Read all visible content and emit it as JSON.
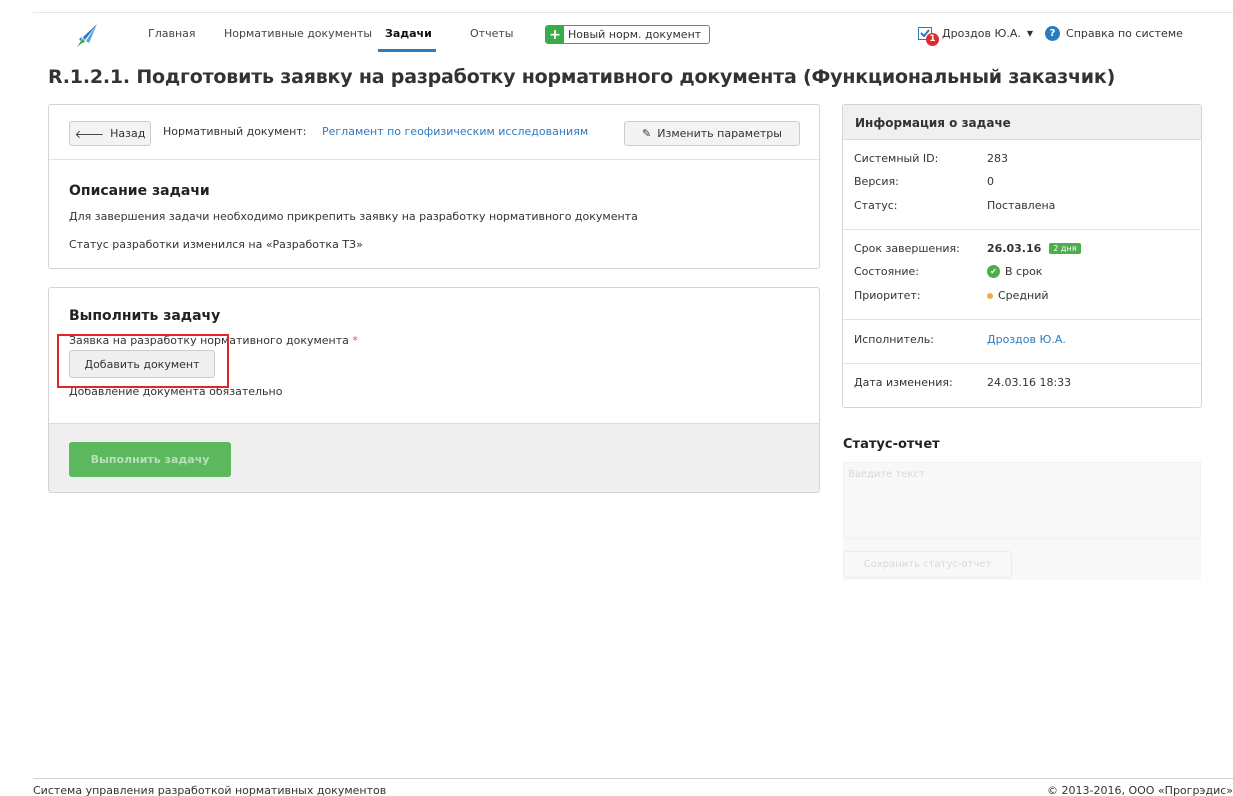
{
  "nav": {
    "items": [
      "Главная",
      "Нормативные документы",
      "Задачи",
      "Отчеты"
    ],
    "active": "Задачи",
    "new_doc": "Новый норм. документ",
    "user": "Дроздов Ю.А.",
    "notifications": "1",
    "help": "Справка по системе"
  },
  "page_title": "R.1.2.1. Подготовить заявку на разработку нормативного документа (Функциональный заказчик)",
  "task": {
    "back": "Назад",
    "doc_label": "Нормативный документ:",
    "doc_link": "Регламент по геофизическим исследованиям",
    "edit_params": "Изменить параметры",
    "desc_title": "Описание задачи",
    "desc_text": "Для завершения задачи необходимо прикрепить заявку на разработку нормативного документа",
    "status_text": "Статус разработки изменился на «Разработка ТЗ»"
  },
  "execute": {
    "title": "Выполнить задачу",
    "field_label": "Заявка на разработку нормативного документа",
    "required_mark": "*",
    "add_doc": "Добавить документ",
    "hint": "Добавление документа обязательно",
    "exec_btn": "Выполнить задачу"
  },
  "info": {
    "title": "Информация о задаче",
    "system_id_label": "Системный ID:",
    "system_id": "283",
    "version_label": "Версия:",
    "version": "0",
    "status_label": "Статус:",
    "status": "Поставлена",
    "due_label": "Срок завершения:",
    "due": "26.03.16",
    "due_badge": "2 дня",
    "state_label": "Состояние:",
    "state": "В срок",
    "priority_label": "Приоритет:",
    "priority": "Средний",
    "assignee_label": "Исполнитель:",
    "assignee": "Дроздов Ю.А.",
    "modified_label": "Дата изменения:",
    "modified": "24.03.16 18:33",
    "colors": {
      "ok": "#4cae4c",
      "priority_medium": "#f0ad4e"
    }
  },
  "status_report": {
    "title": "Статус-отчет",
    "placeholder": "Введите текст",
    "save": "Сохранить статус-отчет"
  },
  "footer": {
    "left": "Система управления разработкой нормативных документов",
    "right": "© 2013-2016, ООО «Прогрэдис»"
  }
}
